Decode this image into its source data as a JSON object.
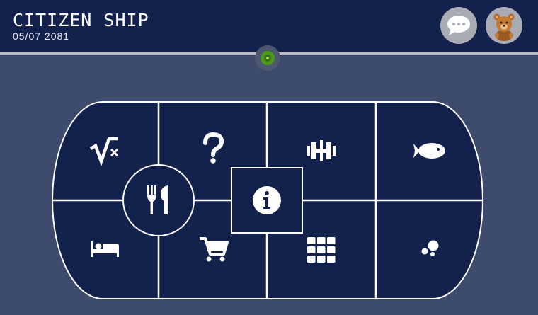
{
  "header": {
    "title": "CITIZEN SHIP",
    "date": "05/07 2081"
  },
  "header_buttons": [
    {
      "icon": "chat-bubble-icon"
    },
    {
      "icon": "teddy-bear-icon"
    }
  ],
  "status_indicator": {
    "state": "online",
    "color": "#4d9a1b"
  },
  "menu": {
    "tiles": [
      {
        "icon": "math-sqrt-icon"
      },
      {
        "icon": "question-mark-icon"
      },
      {
        "icon": "dumbbell-icon"
      },
      {
        "icon": "fish-icon"
      },
      {
        "icon": "bed-icon"
      },
      {
        "icon": "shopping-cart-icon"
      },
      {
        "icon": "grid-icon"
      },
      {
        "icon": "bubbles-icon"
      },
      {
        "icon": "fork-knife-icon"
      },
      {
        "icon": "info-icon"
      }
    ]
  },
  "colors": {
    "header_bg": "#13214d",
    "page_bg": "#3d4b6c",
    "board_bg": "#13214d",
    "lines": "#ffffff",
    "button_bg": "#a9acb5"
  }
}
